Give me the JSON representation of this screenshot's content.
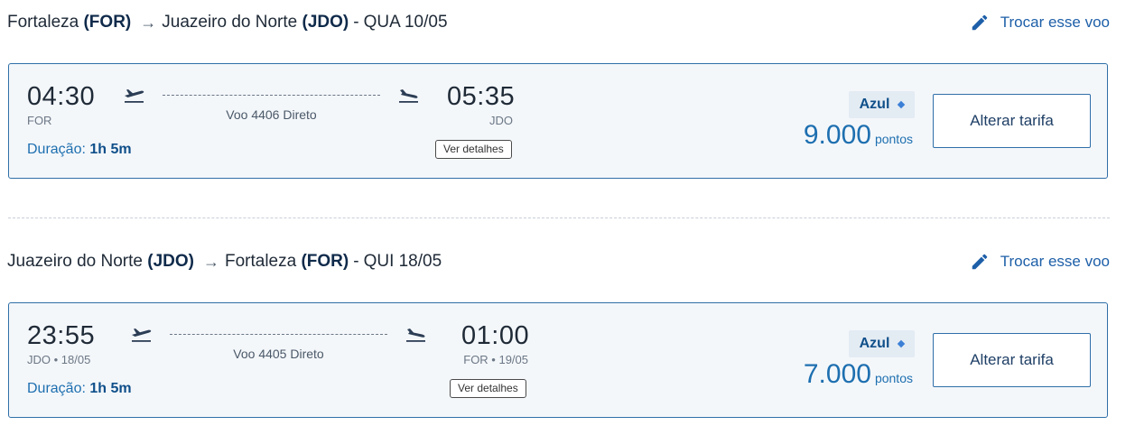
{
  "segments": [
    {
      "origin_city": "Fortaleza",
      "origin_code": "(FOR)",
      "arrow": "→",
      "dest_city": "Juazeiro do Norte",
      "dest_code": "(JDO)",
      "separator": "-",
      "date": "QUA 10/05",
      "change_label": "Trocar esse voo",
      "depart_time": "04:30",
      "depart_info": "FOR",
      "arrive_time": "05:35",
      "arrive_info": "JDO",
      "flight_label": "Voo 4406 Direto",
      "duration_label": "Duração:",
      "duration_value": "1h 5m",
      "details_label": "Ver detalhes",
      "fare_name": "Azul",
      "price_amount": "9.000",
      "price_unit": "pontos",
      "alter_label": "Alterar tarifa"
    },
    {
      "origin_city": "Juazeiro do Norte",
      "origin_code": "(JDO)",
      "arrow": "→",
      "dest_city": "Fortaleza",
      "dest_code": "(FOR)",
      "separator": "-",
      "date": "QUI 18/05",
      "change_label": "Trocar esse voo",
      "depart_time": "23:55",
      "depart_info": "JDO • 18/05",
      "arrive_time": "01:00",
      "arrive_info": "FOR • 19/05",
      "flight_label": "Voo 4405 Direto",
      "duration_label": "Duração:",
      "duration_value": "1h 5m",
      "details_label": "Ver detalhes",
      "fare_name": "Azul",
      "price_amount": "7.000",
      "price_unit": "pontos",
      "alter_label": "Alterar tarifa"
    }
  ],
  "icons": {
    "edit": "pencil-icon",
    "takeoff": "plane-takeoff-icon",
    "landing": "plane-landing-icon",
    "fare": "diamond-icon"
  },
  "colors": {
    "accent": "#1d6fb0",
    "card_border": "#2f6fa8",
    "card_bg": "#f4f7fa",
    "badge_bg": "#e3ebf3"
  }
}
